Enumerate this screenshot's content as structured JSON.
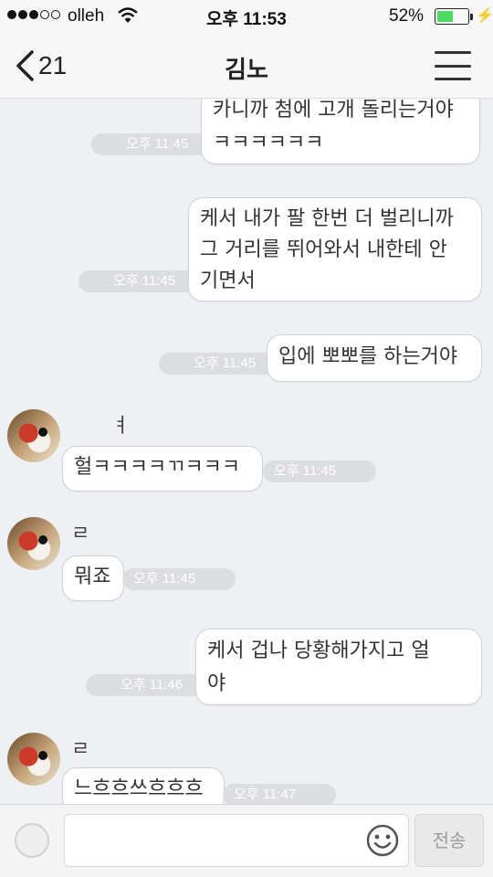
{
  "status_bar": {
    "carrier": "olleh",
    "time": "오후 11:53",
    "battery_percent": "52%",
    "battery_level": 0.52,
    "signal_bars_filled": 3,
    "signal_bars_total": 5
  },
  "nav": {
    "back_count": "21",
    "title": "김노"
  },
  "messages": [
    {
      "side": "right",
      "lines": [
        "카니까 첨에 고개 돌리는거야",
        "ㅋㅋㅋㅋㅋㅋ"
      ],
      "time": "오후 11:45"
    },
    {
      "side": "right",
      "lines": [
        "케서 내가 팔 한번 더 벌리니까",
        "그 거리를 뛰어와서 내한테 안",
        "기면서"
      ],
      "time": "오후 11:45"
    },
    {
      "side": "right",
      "lines": [
        "입에 뽀뽀를 하는거야"
      ],
      "time": "오후 11:45"
    },
    {
      "side": "left",
      "sender": "ㅕ",
      "lines": [
        "헐ㅋㅋㅋㅋㄲㅋㅋㅋ"
      ],
      "time": "오후 11:45"
    },
    {
      "side": "left",
      "sender": "ㄹ",
      "lines": [
        "뭐죠"
      ],
      "time": "오후 11:45"
    },
    {
      "side": "right",
      "lines": [
        "케서 겁나 당황해가지고 얼",
        "야"
      ],
      "time": "오후 11:46"
    },
    {
      "side": "left",
      "sender": "ㄹ",
      "lines": [
        "느흐흐쓰흐흐흐"
      ],
      "time": "오후 11:47"
    }
  ],
  "input": {
    "placeholder": "",
    "send_label": "전송"
  },
  "colors": {
    "background": "#eef0f3",
    "bubble": "#ffffff",
    "time_pill": "#dcdde0",
    "battery": "#4cd964"
  }
}
